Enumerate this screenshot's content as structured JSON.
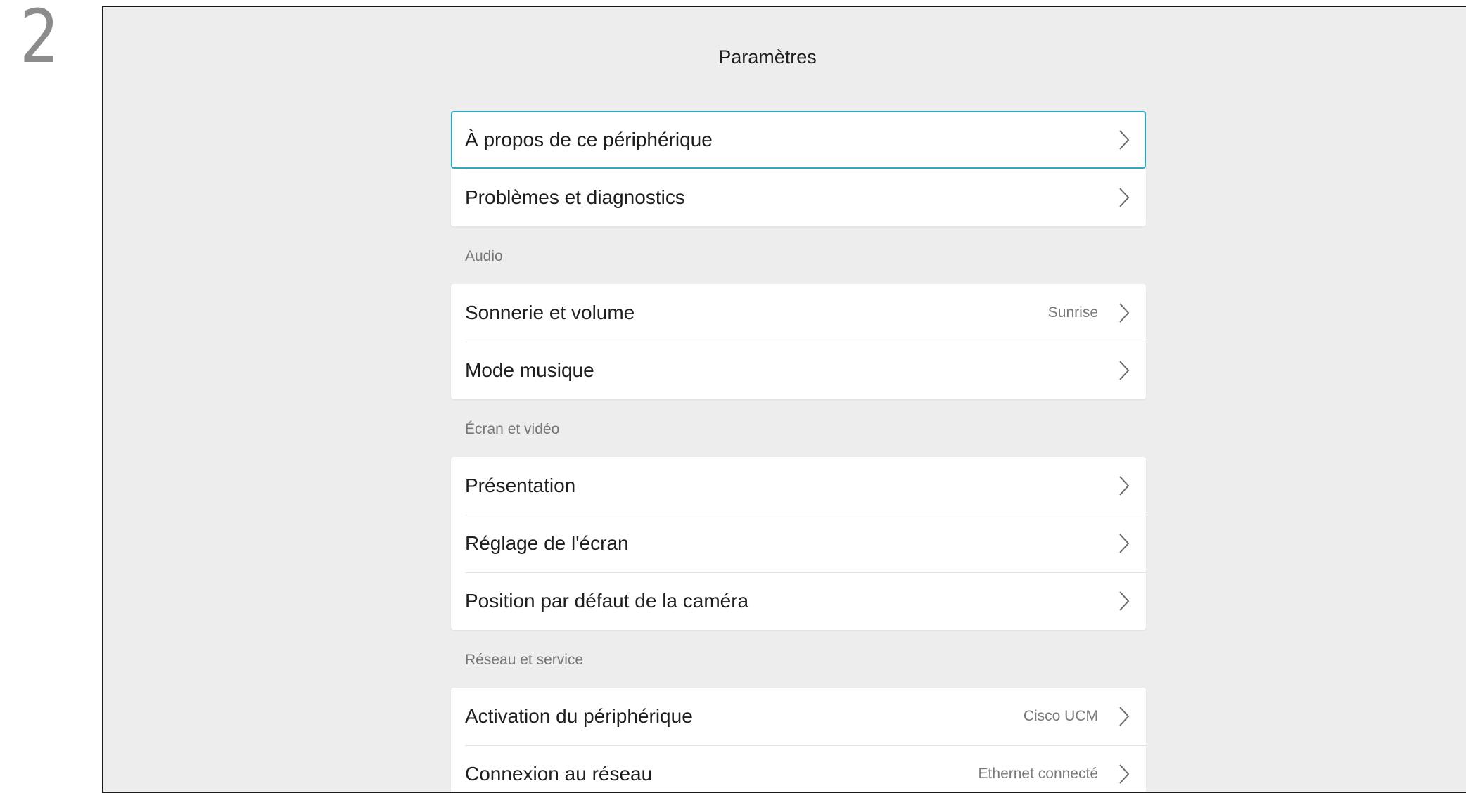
{
  "step": "2",
  "title": "Paramètres",
  "groups": [
    {
      "header": "",
      "items": [
        {
          "label": "À propos de ce périphérique",
          "value": "",
          "selected": true
        },
        {
          "label": "Problèmes et diagnostics",
          "value": ""
        }
      ]
    },
    {
      "header": "Audio",
      "items": [
        {
          "label": "Sonnerie et volume",
          "value": "Sunrise"
        },
        {
          "label": "Mode musique",
          "value": ""
        }
      ]
    },
    {
      "header": "Écran et vidéo",
      "items": [
        {
          "label": "Présentation",
          "value": ""
        },
        {
          "label": "Réglage de l'écran",
          "value": ""
        },
        {
          "label": "Position par défaut de la caméra",
          "value": ""
        }
      ]
    },
    {
      "header": "Réseau et service",
      "items": [
        {
          "label": "Activation du périphérique",
          "value": "Cisco UCM"
        },
        {
          "label": "Connexion au réseau",
          "value": "Ethernet connecté"
        }
      ]
    }
  ],
  "colors": {
    "background": "#ededed",
    "card": "#ffffff",
    "focus_border": "#2ea8bf",
    "text_primary": "#1e1e1e",
    "text_secondary": "#767676"
  },
  "icons": {
    "row_chevron": "chevron-right-icon"
  }
}
